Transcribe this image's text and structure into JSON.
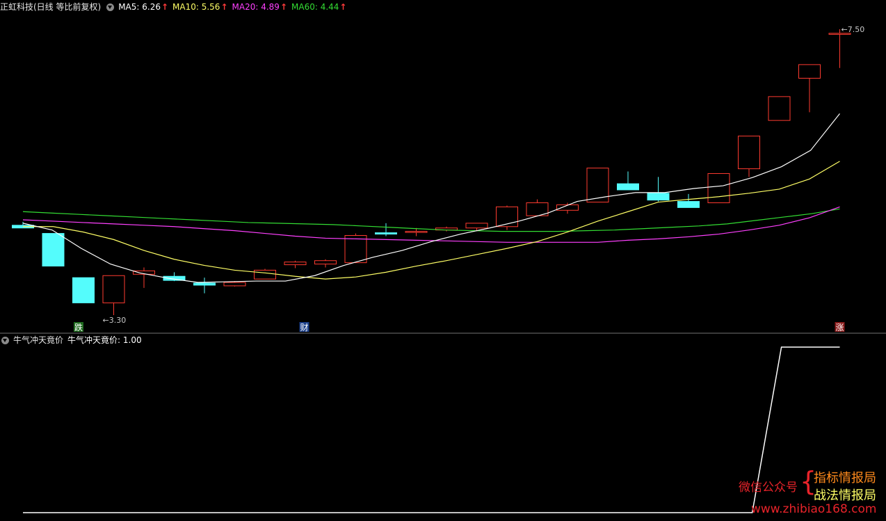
{
  "header": {
    "stock_title": "正虹科技(日线 等比前复权)",
    "ma5": "MA5: 6.26",
    "ma10": "MA10: 5.56",
    "ma20": "MA20: 4.89",
    "ma60": "MA60: 4.44",
    "arrow": "↑"
  },
  "colors": {
    "up": "#ff3b30",
    "down": "#54fcfc",
    "ma5": "#ffffff",
    "ma10": "#ffff66",
    "ma20": "#ff40ff",
    "ma60": "#33dd33",
    "grid": "#3a3a3a"
  },
  "indicator": {
    "name": "牛气冲天竟价",
    "value_label": "牛气冲天竟价: 1.00"
  },
  "markers": {
    "low_label": "3.30",
    "high_label": "7.50",
    "down_mark": "跌",
    "cai_mark": "财",
    "up_mark": "涨"
  },
  "watermark": {
    "wechat": "微信公众号",
    "line1": "指标情报局",
    "line2": "战法情报局",
    "site": "www.zhibiao168.com"
  },
  "chart_data": {
    "type": "candlestick",
    "title": "正虹科技(日线 等比前复权)",
    "ylim": [
      3.1,
      7.7
    ],
    "candles": [
      {
        "o": 4.62,
        "h": 4.67,
        "l": 4.58,
        "c": 4.58
      },
      {
        "o": 4.5,
        "h": 4.5,
        "l": 4.02,
        "c": 4.02
      },
      {
        "o": 3.85,
        "h": 3.85,
        "l": 3.48,
        "c": 3.48
      },
      {
        "o": 3.48,
        "h": 3.88,
        "l": 3.3,
        "c": 3.88
      },
      {
        "o": 3.9,
        "h": 4.0,
        "l": 3.7,
        "c": 3.95
      },
      {
        "o": 3.87,
        "h": 3.93,
        "l": 3.8,
        "c": 3.81
      },
      {
        "o": 3.77,
        "h": 3.85,
        "l": 3.62,
        "c": 3.74
      },
      {
        "o": 3.73,
        "h": 3.8,
        "l": 3.72,
        "c": 3.78
      },
      {
        "o": 3.83,
        "h": 3.98,
        "l": 3.83,
        "c": 3.96
      },
      {
        "o": 4.04,
        "h": 4.1,
        "l": 3.99,
        "c": 4.08
      },
      {
        "o": 4.05,
        "h": 4.12,
        "l": 4.0,
        "c": 4.1
      },
      {
        "o": 4.07,
        "h": 4.5,
        "l": 4.07,
        "c": 4.47
      },
      {
        "o": 4.51,
        "h": 4.65,
        "l": 4.46,
        "c": 4.49
      },
      {
        "o": 4.53,
        "h": 4.58,
        "l": 4.46,
        "c": 4.53
      },
      {
        "o": 4.55,
        "h": 4.6,
        "l": 4.53,
        "c": 4.58
      },
      {
        "o": 4.58,
        "h": 4.65,
        "l": 4.54,
        "c": 4.65
      },
      {
        "o": 4.6,
        "h": 4.91,
        "l": 4.55,
        "c": 4.89
      },
      {
        "o": 4.76,
        "h": 5.0,
        "l": 4.76,
        "c": 4.95
      },
      {
        "o": 4.84,
        "h": 4.95,
        "l": 4.79,
        "c": 4.92
      },
      {
        "o": 4.96,
        "h": 5.46,
        "l": 4.96,
        "c": 5.46
      },
      {
        "o": 5.23,
        "h": 5.41,
        "l": 5.14,
        "c": 5.14
      },
      {
        "o": 5.09,
        "h": 5.33,
        "l": 4.97,
        "c": 4.99
      },
      {
        "o": 4.97,
        "h": 5.08,
        "l": 4.88,
        "c": 4.88
      },
      {
        "o": 4.95,
        "h": 5.38,
        "l": 4.95,
        "c": 5.38
      },
      {
        "o": 5.45,
        "h": 5.93,
        "l": 5.33,
        "c": 5.93
      },
      {
        "o": 6.16,
        "h": 6.51,
        "l": 6.16,
        "c": 6.51
      },
      {
        "o": 6.78,
        "h": 6.98,
        "l": 6.28,
        "c": 6.98
      },
      {
        "o": 7.44,
        "h": 7.5,
        "l": 6.93,
        "c": 7.44
      }
    ],
    "ma5": [
      4.65,
      4.55,
      4.28,
      4.05,
      3.92,
      3.84,
      3.78,
      3.79,
      3.8,
      3.8,
      3.88,
      4.03,
      4.15,
      4.25,
      4.38,
      4.49,
      4.58,
      4.68,
      4.8,
      4.97,
      5.04,
      5.1,
      5.1,
      5.16,
      5.2,
      5.32,
      5.48,
      5.72,
      6.26
    ],
    "ma10": [
      4.6,
      4.6,
      4.52,
      4.41,
      4.25,
      4.12,
      4.03,
      3.96,
      3.92,
      3.87,
      3.83,
      3.86,
      3.93,
      4.02,
      4.1,
      4.19,
      4.28,
      4.38,
      4.52,
      4.68,
      4.82,
      4.96,
      5.0,
      5.04,
      5.09,
      5.15,
      5.3,
      5.56
    ],
    "ma20": [
      4.7,
      4.68,
      4.66,
      4.64,
      4.62,
      4.6,
      4.57,
      4.54,
      4.5,
      4.46,
      4.43,
      4.42,
      4.41,
      4.4,
      4.39,
      4.38,
      4.37,
      4.37,
      4.37,
      4.37,
      4.4,
      4.42,
      4.45,
      4.49,
      4.55,
      4.62,
      4.73,
      4.89
    ],
    "ma60": [
      4.82,
      4.8,
      4.78,
      4.76,
      4.74,
      4.72,
      4.7,
      4.68,
      4.66,
      4.65,
      4.64,
      4.63,
      4.61,
      4.59,
      4.57,
      4.55,
      4.54,
      4.53,
      4.53,
      4.53,
      4.54,
      4.55,
      4.57,
      4.59,
      4.61,
      4.64,
      4.69,
      4.74,
      4.79,
      4.86
    ],
    "indicator_values": [
      0,
      0,
      0,
      0,
      0,
      0,
      0,
      0,
      0,
      0,
      0,
      0,
      0,
      0,
      0,
      0,
      0,
      0,
      0,
      0,
      0,
      0,
      0,
      0,
      0,
      0,
      1,
      1,
      1
    ]
  }
}
